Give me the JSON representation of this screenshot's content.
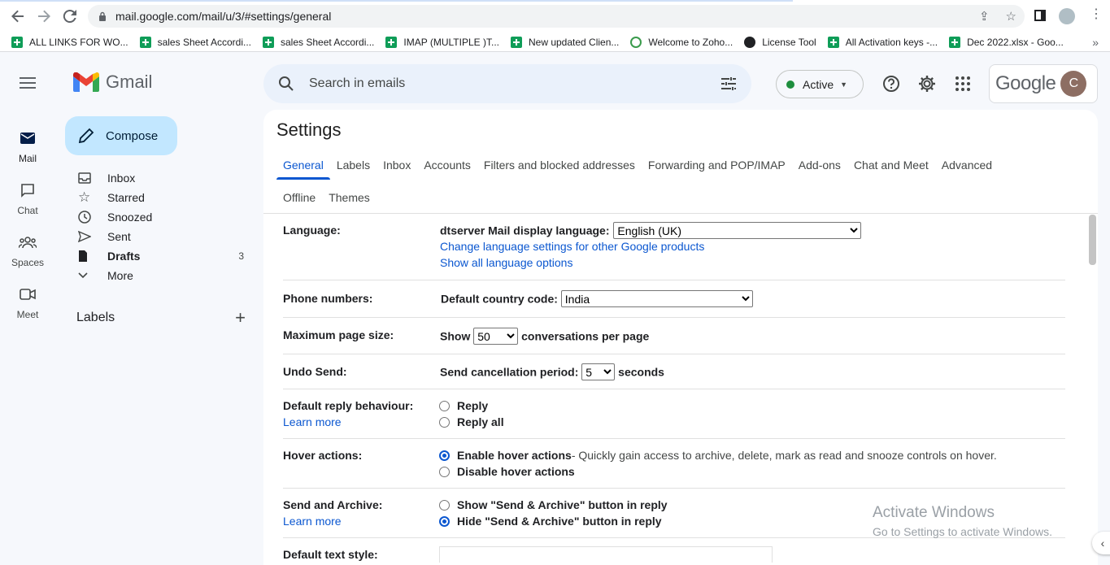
{
  "browser": {
    "url": "mail.google.com/mail/u/3/#settings/general",
    "bookmarks": [
      {
        "label": "ALL LINKS FOR WO...",
        "icon": "sheets-icon"
      },
      {
        "label": "sales Sheet Accordi...",
        "icon": "sheets-icon"
      },
      {
        "label": "sales Sheet Accordi...",
        "icon": "sheets-icon"
      },
      {
        "label": "IMAP (MULTIPLE )T...",
        "icon": "sheets-icon"
      },
      {
        "label": "New updated Clien...",
        "icon": "sheets-icon"
      },
      {
        "label": "Welcome to Zoho...",
        "icon": "zoho-icon"
      },
      {
        "label": "License Tool",
        "icon": "license-icon"
      },
      {
        "label": "All Activation keys -...",
        "icon": "sheets-icon"
      },
      {
        "label": "Dec 2022.xlsx - Goo...",
        "icon": "sheets-icon"
      }
    ],
    "more": "»"
  },
  "app": {
    "name": "Gmail",
    "google": "Google",
    "avatar_letter": "C"
  },
  "rail": {
    "mail": "Mail",
    "chat": "Chat",
    "spaces": "Spaces",
    "meet": "Meet"
  },
  "compose": "Compose",
  "nav": [
    {
      "label": "Inbox",
      "count": ""
    },
    {
      "label": "Starred",
      "count": ""
    },
    {
      "label": "Snoozed",
      "count": ""
    },
    {
      "label": "Sent",
      "count": ""
    },
    {
      "label": "Drafts",
      "count": "3"
    },
    {
      "label": "More",
      "count": ""
    }
  ],
  "labels_header": "Labels",
  "search": {
    "placeholder": "Search in emails"
  },
  "status": "Active",
  "settings": {
    "title": "Settings",
    "tabs_row1": [
      "General",
      "Labels",
      "Inbox",
      "Accounts",
      "Filters and blocked addresses",
      "Forwarding and POP/IMAP",
      "Add-ons",
      "Chat and Meet",
      "Advanced"
    ],
    "tabs_row2": [
      "Offline",
      "Themes"
    ],
    "language": {
      "label": "Language:",
      "prefix": "dtserver Mail display language:",
      "value": "English (UK)",
      "link1": "Change language settings for other Google products",
      "link2": "Show all language options"
    },
    "phone": {
      "label": "Phone numbers:",
      "prefix": "Default country code:",
      "value": "India"
    },
    "page_size": {
      "label": "Maximum page size:",
      "prefix": "Show",
      "value": "50",
      "suffix": "conversations per page"
    },
    "undo": {
      "label": "Undo Send:",
      "prefix": "Send cancellation period:",
      "value": "5",
      "suffix": "seconds"
    },
    "reply": {
      "label": "Default reply behaviour:",
      "learn": "Learn more",
      "opt1": "Reply",
      "opt2": "Reply all"
    },
    "hover": {
      "label": "Hover actions:",
      "opt1": "Enable hover actions",
      "opt1_desc": " - Quickly gain access to archive, delete, mark as read and snooze controls on hover.",
      "opt2": "Disable hover actions"
    },
    "send_archive": {
      "label": "Send and Archive:",
      "learn": "Learn more",
      "opt1": "Show \"Send & Archive\" button in reply",
      "opt2": "Hide \"Send & Archive\" button in reply"
    },
    "text_style": {
      "label": "Default text style:"
    }
  },
  "watermark": {
    "line1": "Activate Windows",
    "line2": "Go to Settings to activate Windows."
  }
}
